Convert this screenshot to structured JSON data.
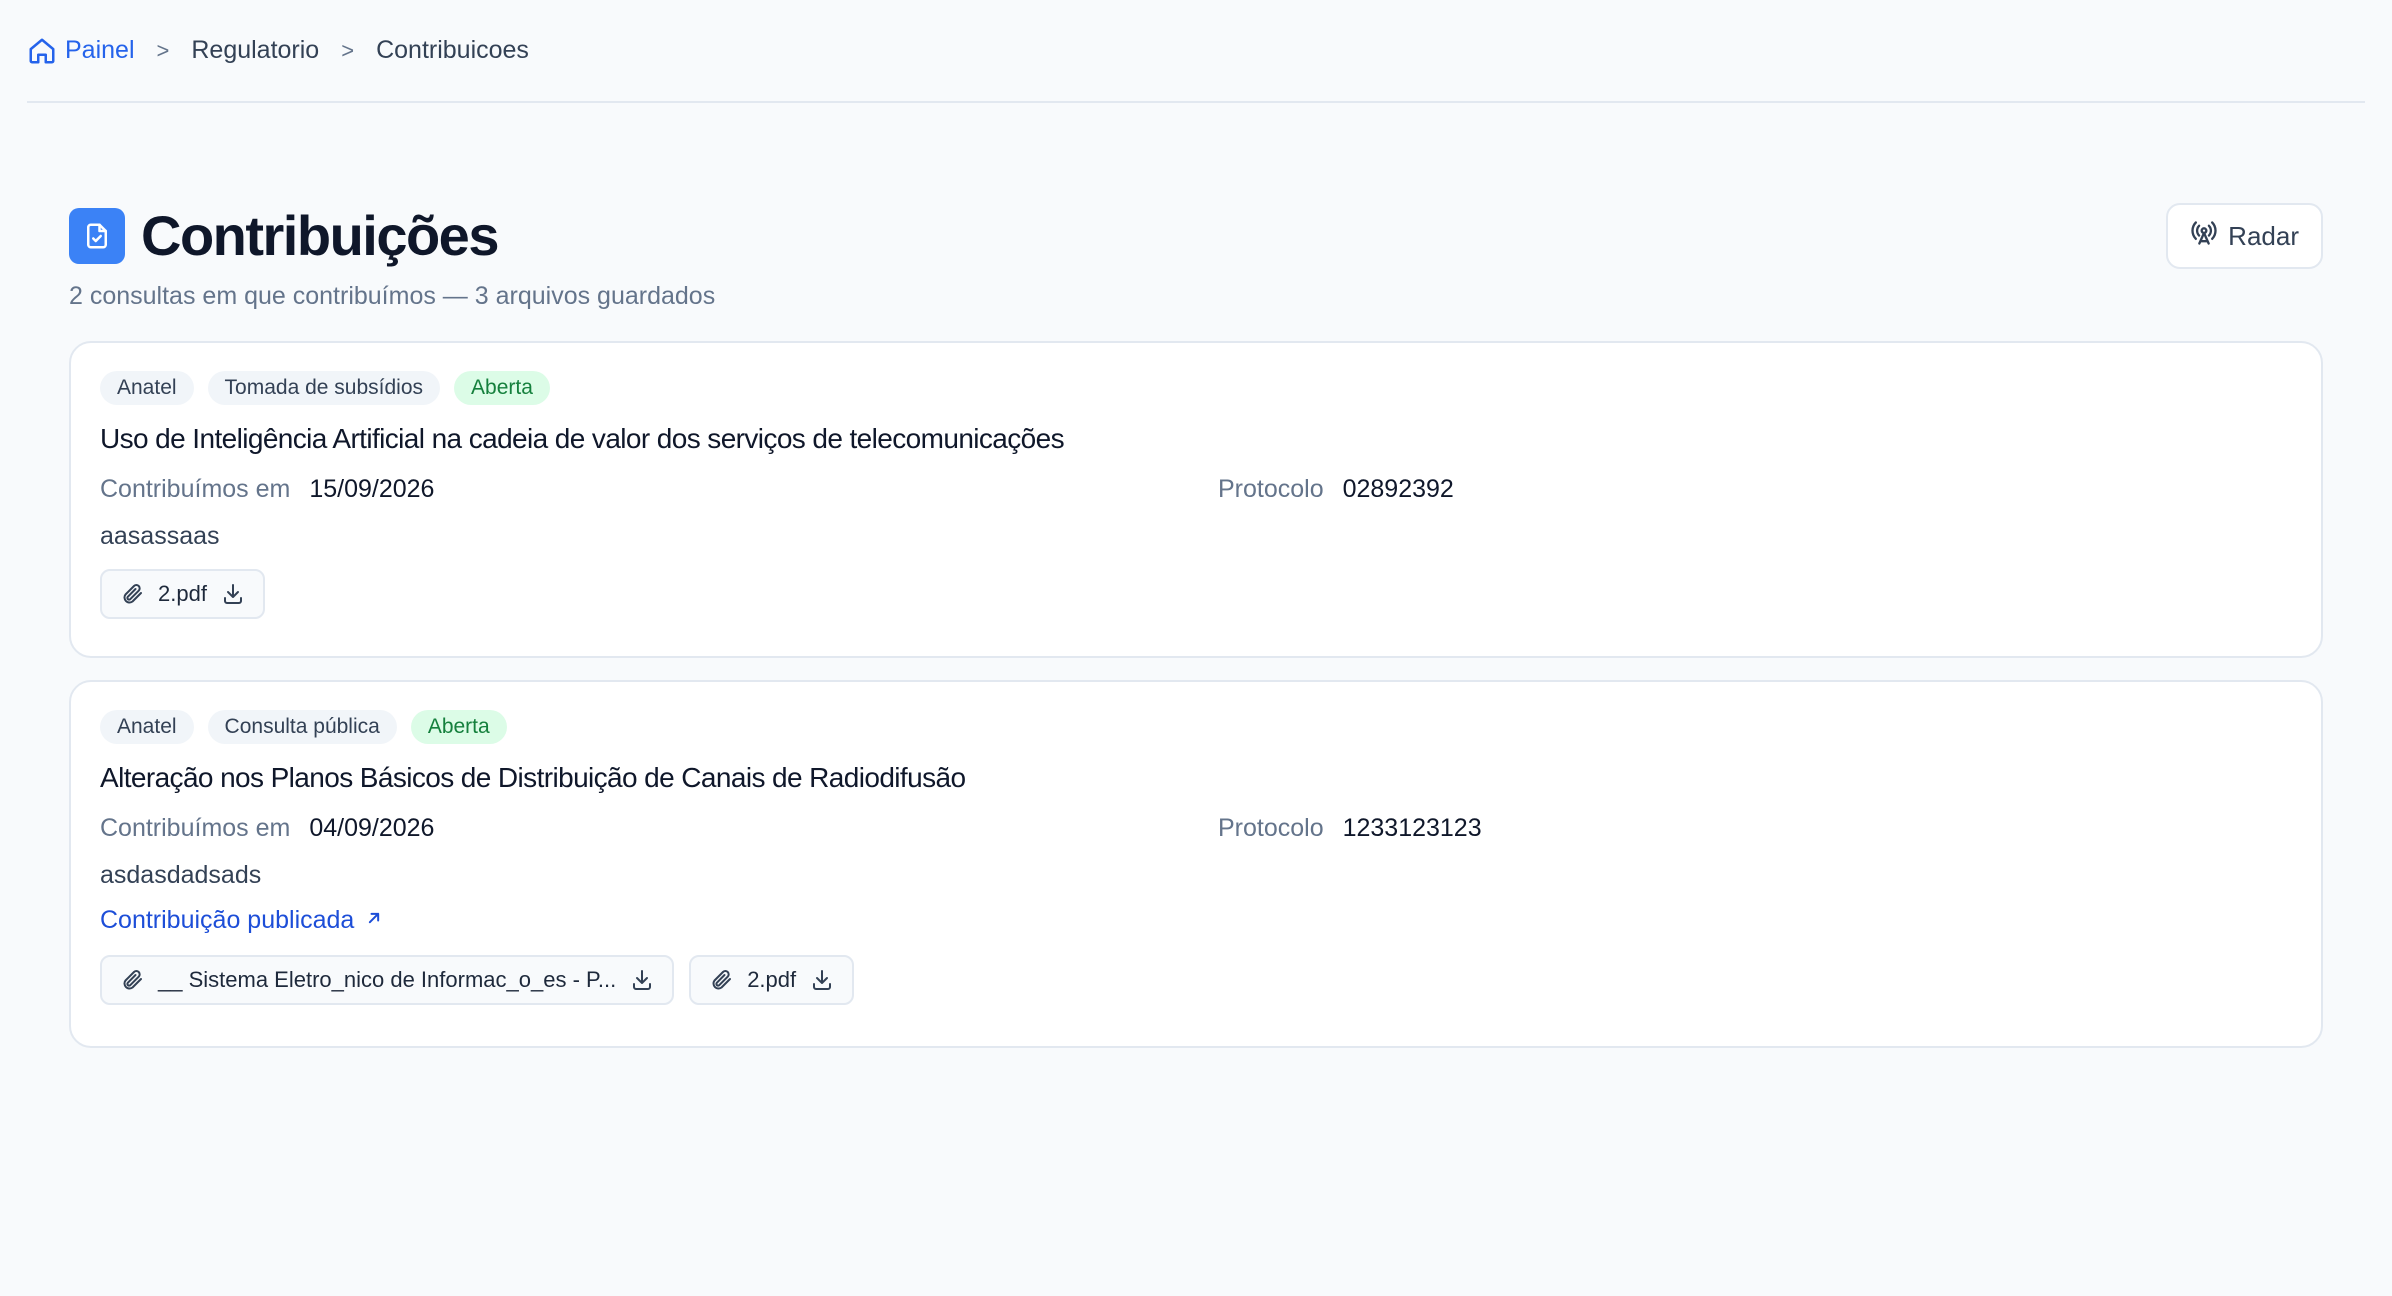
{
  "breadcrumb": {
    "items": [
      {
        "label": "Painel",
        "icon": "home-icon"
      },
      {
        "label": "Regulatorio"
      },
      {
        "label": "Contribuicoes"
      }
    ],
    "separator": ">"
  },
  "header": {
    "title": "Contribuições",
    "subtitle": "2 consultas em que contribuímos — 3 arquivos guardados",
    "icon": "document-check-icon",
    "radar_label": "Radar",
    "radar_icon": "broadcast-icon"
  },
  "cards": [
    {
      "tags": [
        "Anatel",
        "Tomada de subsídios",
        "Aberta"
      ],
      "title": "Uso de Inteligência Artificial na cadeia de valor dos serviços de telecomunicações",
      "contributed_label": "Contribuímos em",
      "contributed_date": "15/09/2026",
      "protocol_label": "Protocolo",
      "protocol_value": "02892392",
      "note": "aasassaas",
      "files": [
        "2.pdf"
      ]
    },
    {
      "tags": [
        "Anatel",
        "Consulta pública",
        "Aberta"
      ],
      "title": "Alteração nos Planos Básicos de Distribuição de Canais de Radiodifusão",
      "contributed_label": "Contribuímos em",
      "contributed_date": "04/09/2026",
      "protocol_label": "Protocolo",
      "protocol_value": "1233123123",
      "note": "asdasdadsads",
      "link_label": "Contribuição publicada",
      "files": [
        "__ Sistema Eletro_nico de Informac_o_es - P...",
        "2.pdf"
      ]
    }
  ],
  "colors": {
    "accent": "#2563eb",
    "open_tag_bg": "#dcfce7",
    "open_tag_text": "#15803d",
    "background": "#f8fafc"
  }
}
